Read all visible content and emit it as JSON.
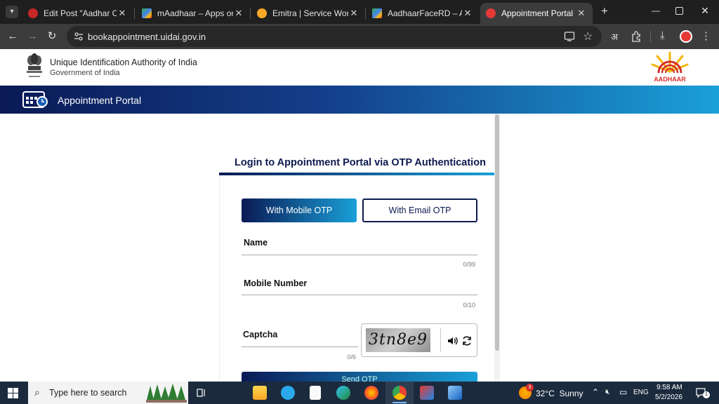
{
  "browser": {
    "tabs": [
      {
        "label": "Edit Post \"Aadhar Card M",
        "favicon_color": "#c62828",
        "active": false
      },
      {
        "label": "mAadhaar – Apps on Goo",
        "favicon_color": "#34a853",
        "active": false
      },
      {
        "label": "Emitra | Service Workflow",
        "favicon_color": "#f9a825",
        "active": false
      },
      {
        "label": "AadhaarFaceRD – Apps o",
        "favicon_color": "#34a853",
        "active": false
      },
      {
        "label": "Appointment Portal",
        "favicon_color": "#e53935",
        "active": true
      }
    ],
    "url": "bookappointment.uidai.gov.in",
    "translate_glyph": "अ"
  },
  "header": {
    "org_name": "Unique Identification Authority of India",
    "org_gov": "Government of India",
    "logo_text": "AADHAAR"
  },
  "banner": {
    "title": "Appointment Portal"
  },
  "login": {
    "heading": "Login to Appointment Portal via OTP Authentication",
    "mobile_otp_label": "With Mobile OTP",
    "email_otp_label": "With Email OTP",
    "name_label": "Name",
    "name_count": "0/99",
    "mobile_label": "Mobile Number",
    "mobile_count": "0/10",
    "captcha_label": "Captcha",
    "captcha_count": "0/6",
    "captcha_text": "3tn8e9",
    "send_otp_label": "Send OTP"
  },
  "taskbar": {
    "search_placeholder": "Type here to search",
    "weather_badge": "3",
    "weather": "32°C  Sunny",
    "language": "ENG",
    "time": "9:58 AM",
    "date": "5/2/2026",
    "notification_count": "1"
  },
  "colors": {
    "brand_dark": "#0a1a55",
    "brand_light": "#1aa0d8",
    "heading": "#0c1a4f"
  }
}
